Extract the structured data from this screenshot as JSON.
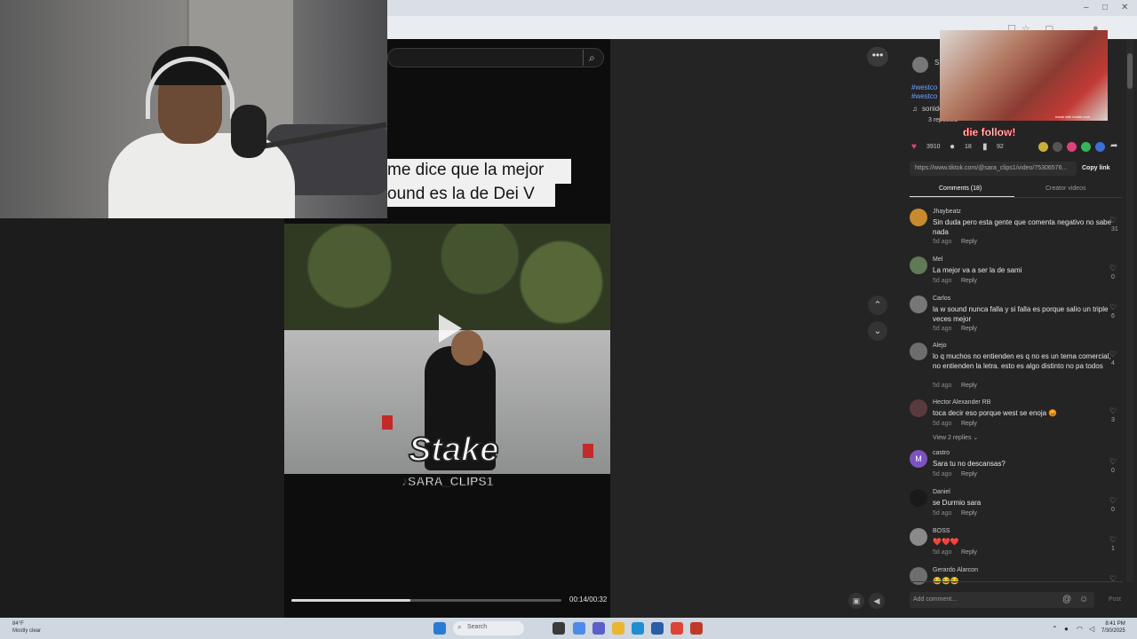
{
  "window": {
    "minimize": "–",
    "maximize": "□",
    "close": "✕"
  },
  "search": {
    "icon": "search-icon"
  },
  "video": {
    "caption_line1": "me dice que la mejor",
    "caption_line2": "ound es la de Dei V",
    "overlay_logo": "Stake",
    "watermark": "SARA_CLIPS1",
    "time": "00:14/00:32",
    "progress": 0.44
  },
  "gif": {
    "tag": "made with tumblr.com",
    "follow_text": "die follow!"
  },
  "author": {
    "name": "S",
    "hashtag1": "#westco",
    "hashtag2": "#westco",
    "sound": "sonido",
    "reposted": "3 reposted"
  },
  "stats": {
    "likes": "3910",
    "comments": "18",
    "saves": "92"
  },
  "link": {
    "url": "https://www.tiktok.com/@sara_clips1/video/75306576...",
    "copy_label": "Copy link"
  },
  "tabs": {
    "comments": "Comments (18)",
    "creator_videos": "Creator videos"
  },
  "comments": [
    {
      "user": "Jhaybeatz",
      "text": "Sin duda pero esta gente que comenta negativo no sabe nada",
      "time": "5d ago",
      "reply": "Reply",
      "likes": "31",
      "color": "#c98a2e"
    },
    {
      "user": "Mel",
      "text": "La mejor va a ser la de sami",
      "time": "5d ago",
      "reply": "Reply",
      "likes": "0",
      "color": "#5f7a55"
    },
    {
      "user": "Carlos",
      "text": "la w sound nunca falla y si falla es porque salio un triple veces mejor",
      "time": "5d ago",
      "reply": "Reply",
      "likes": "6",
      "color": "#777777"
    },
    {
      "user": "Alejo",
      "text": "lo q muchos no entienden es q no es un tema comercial, no entienden la letra. esto es algo distinto no pa todos",
      "time": "5d ago",
      "reply": "Reply",
      "likes": "4",
      "color": "#6d6d6d"
    },
    {
      "user": "Hector Alexander RB",
      "text": "toca decir eso porque west se enoja 😡",
      "time": "5d ago",
      "reply": "Reply",
      "likes": "3",
      "color": "#5a3a3a"
    },
    {
      "user": "castro",
      "text": "Sara tu no descansas?",
      "time": "5d ago",
      "reply": "Reply",
      "likes": "0",
      "color": "#7b53c1",
      "initial": "M"
    },
    {
      "user": "Daniel",
      "text": "se Durmio sara",
      "time": "5d ago",
      "reply": "Reply",
      "likes": "0",
      "color": "#1a1a1a"
    },
    {
      "user": "BOSS",
      "text": "❤️❤️❤️",
      "time": "5d ago",
      "reply": "Reply",
      "likes": "1",
      "color": "#8a8a8a"
    },
    {
      "user": "Gerardo Alarcon",
      "text": "😂😂😂",
      "time": "",
      "reply": "",
      "likes": "",
      "color": "#6e6e6e"
    }
  ],
  "view_replies": "View 2 replies ⌄",
  "comment_input": {
    "placeholder": "Add comment...",
    "post": "Post"
  },
  "taskbar": {
    "search": "Search",
    "weather_temp": "84°F",
    "weather_desc": "Mostly clear",
    "time": "8:41 PM",
    "date": "7/30/2025"
  }
}
